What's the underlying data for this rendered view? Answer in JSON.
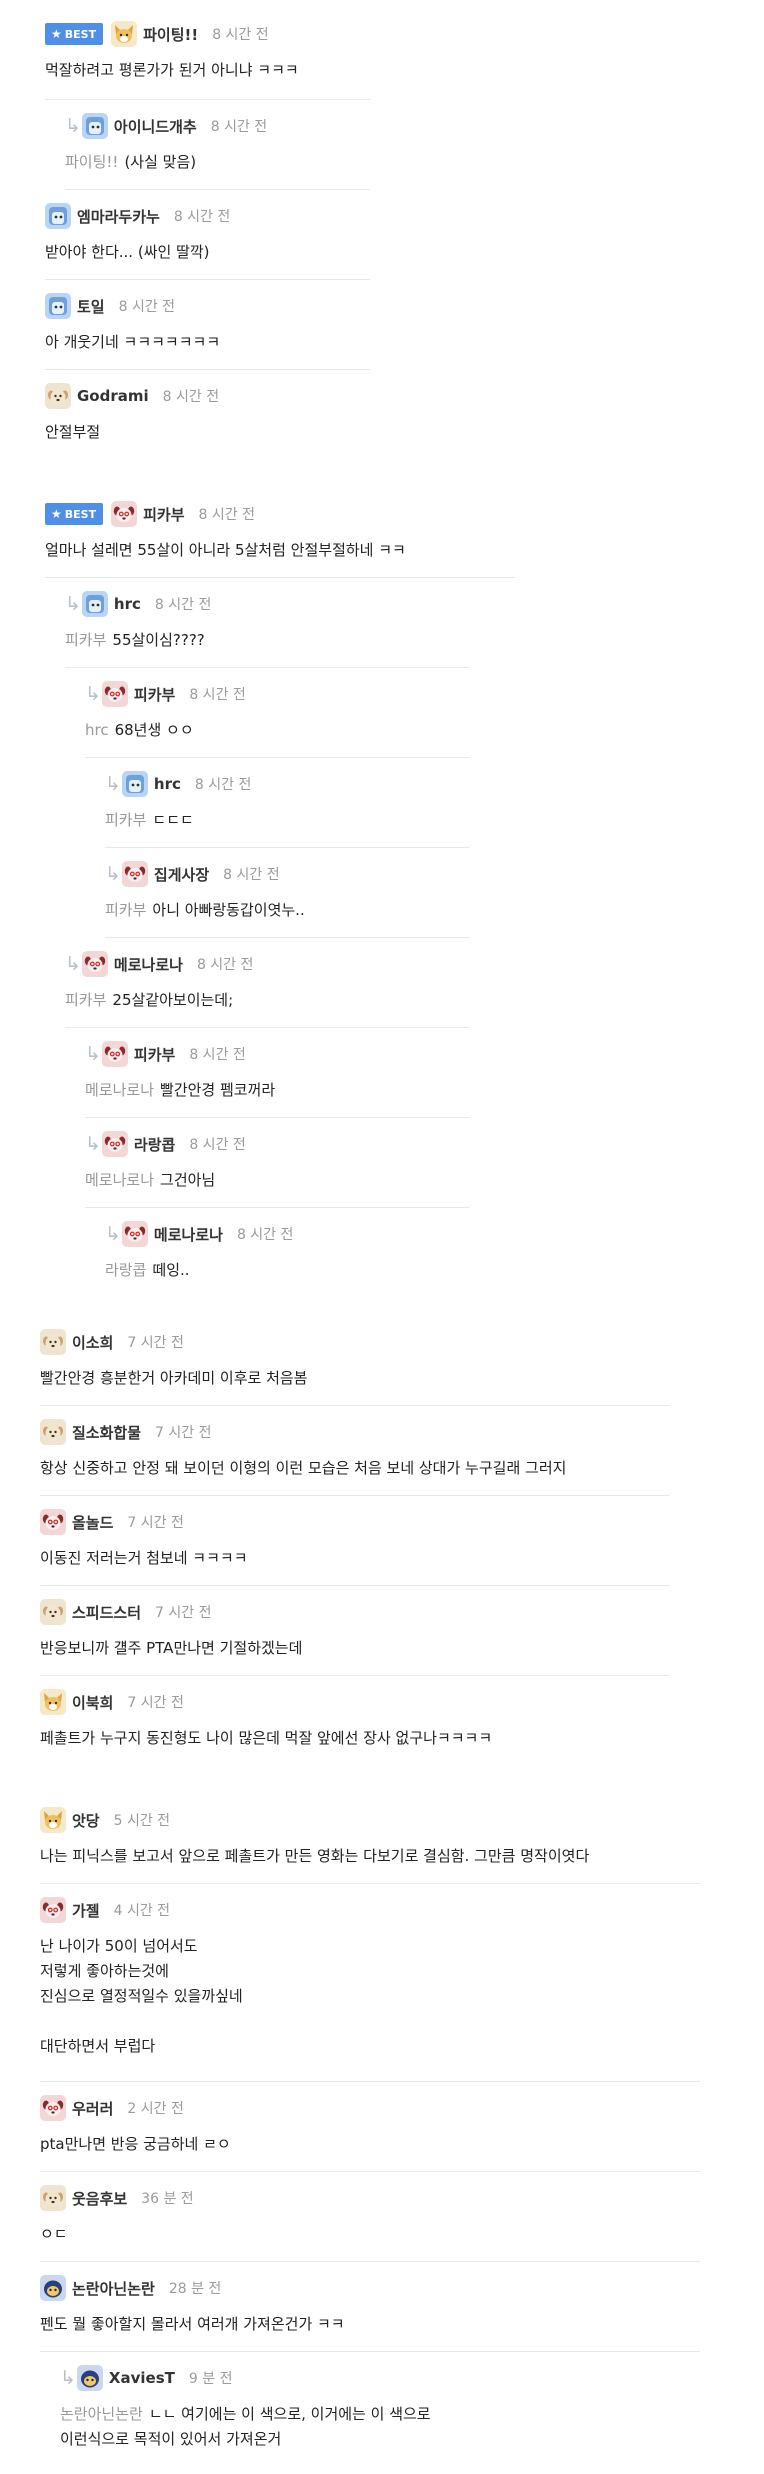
{
  "best_label": "BEST",
  "comments": [
    {
      "nick": "파이팅!!",
      "time": "8 시간 전",
      "text": "먹잘하려고 평론가가 된거 아니냐 ㅋㅋㅋ",
      "best": true,
      "avatar": "fox-icon"
    },
    {
      "nick": "아이니드개추",
      "time": "8 시간 전",
      "mention": "파이팅!!",
      "text": "(사실 맞음)",
      "avatar": "blue-face-icon"
    },
    {
      "nick": "엠마라두카누",
      "time": "8 시간 전",
      "text": "받아야 한다... (싸인 딸깍)",
      "avatar": "blue-face-icon"
    },
    {
      "nick": "토일",
      "time": "8 시간 전",
      "text": "아 개웃기네 ㅋㅋㅋㅋㅋㅋㅋ",
      "avatar": "blue-face-icon"
    },
    {
      "nick": "Godrami",
      "time": "8 시간 전",
      "text": "안절부절",
      "avatar": "puppy-icon"
    },
    {
      "nick": "피카부",
      "time": "8 시간 전",
      "text": "얼마나 설레면 55살이 아니라 5살처럼 안절부절하네 ㅋㅋ",
      "best": true,
      "avatar": "red-dog-icon"
    },
    {
      "nick": "hrc",
      "time": "8 시간 전",
      "mention": "피카부",
      "text": "55살이심????",
      "avatar": "blue-face-icon"
    },
    {
      "nick": "피카부",
      "time": "8 시간 전",
      "mention": "hrc",
      "text": "68년생 ㅇㅇ",
      "avatar": "red-dog-icon"
    },
    {
      "nick": "hrc",
      "time": "8 시간 전",
      "mention": "피카부",
      "text": "ㄷㄷㄷ",
      "avatar": "blue-face-icon"
    },
    {
      "nick": "집게사장",
      "time": "8 시간 전",
      "mention": "피카부",
      "text": "아니 아빠랑동갑이엿누..",
      "avatar": "red-dog-icon"
    },
    {
      "nick": "메로나로나",
      "time": "8 시간 전",
      "mention": "피카부",
      "text": "25살같아보이는데;",
      "avatar": "red-dog-icon"
    },
    {
      "nick": "피카부",
      "time": "8 시간 전",
      "mention": "메로나로나",
      "text": "빨간안경 펨코꺼라",
      "avatar": "red-dog-icon"
    },
    {
      "nick": "라랑콥",
      "time": "8 시간 전",
      "mention": "메로나로나",
      "text": "그건아님",
      "avatar": "red-dog-icon"
    },
    {
      "nick": "메로나로나",
      "time": "8 시간 전",
      "mention": "라랑콥",
      "text": "떼잉..",
      "avatar": "red-dog-icon"
    },
    {
      "nick": "이소희",
      "time": "7 시간 전",
      "text": "빨간안경 흥분한거 아카데미 이후로 처음봄",
      "avatar": "puppy-icon"
    },
    {
      "nick": "질소화합물",
      "time": "7 시간 전",
      "text": "항상 신중하고 안정 돼 보이던 이형의 이런 모습은 처음 보네 상대가 누구길래 그러지",
      "avatar": "puppy-icon"
    },
    {
      "nick": "올놀드",
      "time": "7 시간 전",
      "text": "이동진 저러는거 첨보네 ㅋㅋㅋㅋ",
      "avatar": "red-dog-icon"
    },
    {
      "nick": "스피드스터",
      "time": "7 시간 전",
      "text": "반응보니까 걜주 PTA만나면 기절하겠는데",
      "avatar": "puppy-icon"
    },
    {
      "nick": "이북희",
      "time": "7 시간 전",
      "text": "페촐트가 누구지 동진형도 나이 많은데 먹잘 앞에선 장사 없구나ㅋㅋㅋㅋ",
      "avatar": "fox-icon"
    },
    {
      "nick": "앗당",
      "time": "5 시간 전",
      "text": "나는 피닉스를 보고서 앞으로 페촐트가 만든 영화는 다보기로 결심함. 그만큼 명작이엿다",
      "avatar": "fox-icon"
    },
    {
      "nick": "가젤",
      "time": "4 시간 전",
      "text": "난 나이가 50이 넘어서도\n저렇게 좋아하는것에\n진심으로 열정적일수 있을까싶네\n\n대단하면서 부럽다",
      "avatar": "red-dog-icon"
    },
    {
      "nick": "우러러",
      "time": "2 시간 전",
      "text": "pta만나면 반응 궁금하네 ㄹㅇ",
      "avatar": "red-dog-icon"
    },
    {
      "nick": "웃음후보",
      "time": "36 분 전",
      "text": "ㅇㄷ",
      "avatar": "puppy-icon"
    },
    {
      "nick": "논란아닌논란",
      "time": "28 분 전",
      "text": "펜도 뭘 좋아할지 몰라서 여러개 가져온건가 ㅋㅋ",
      "avatar": "navy-face-icon"
    },
    {
      "nick": "XaviesT",
      "time": "9 분 전",
      "mention": "논란아닌논란",
      "text": "ㄴㄴ 여기에는 이 색으로, 이거에는 이 색으로\n이런식으로 목적이 있어서 가져온거",
      "avatar": "navy-face-icon"
    }
  ]
}
